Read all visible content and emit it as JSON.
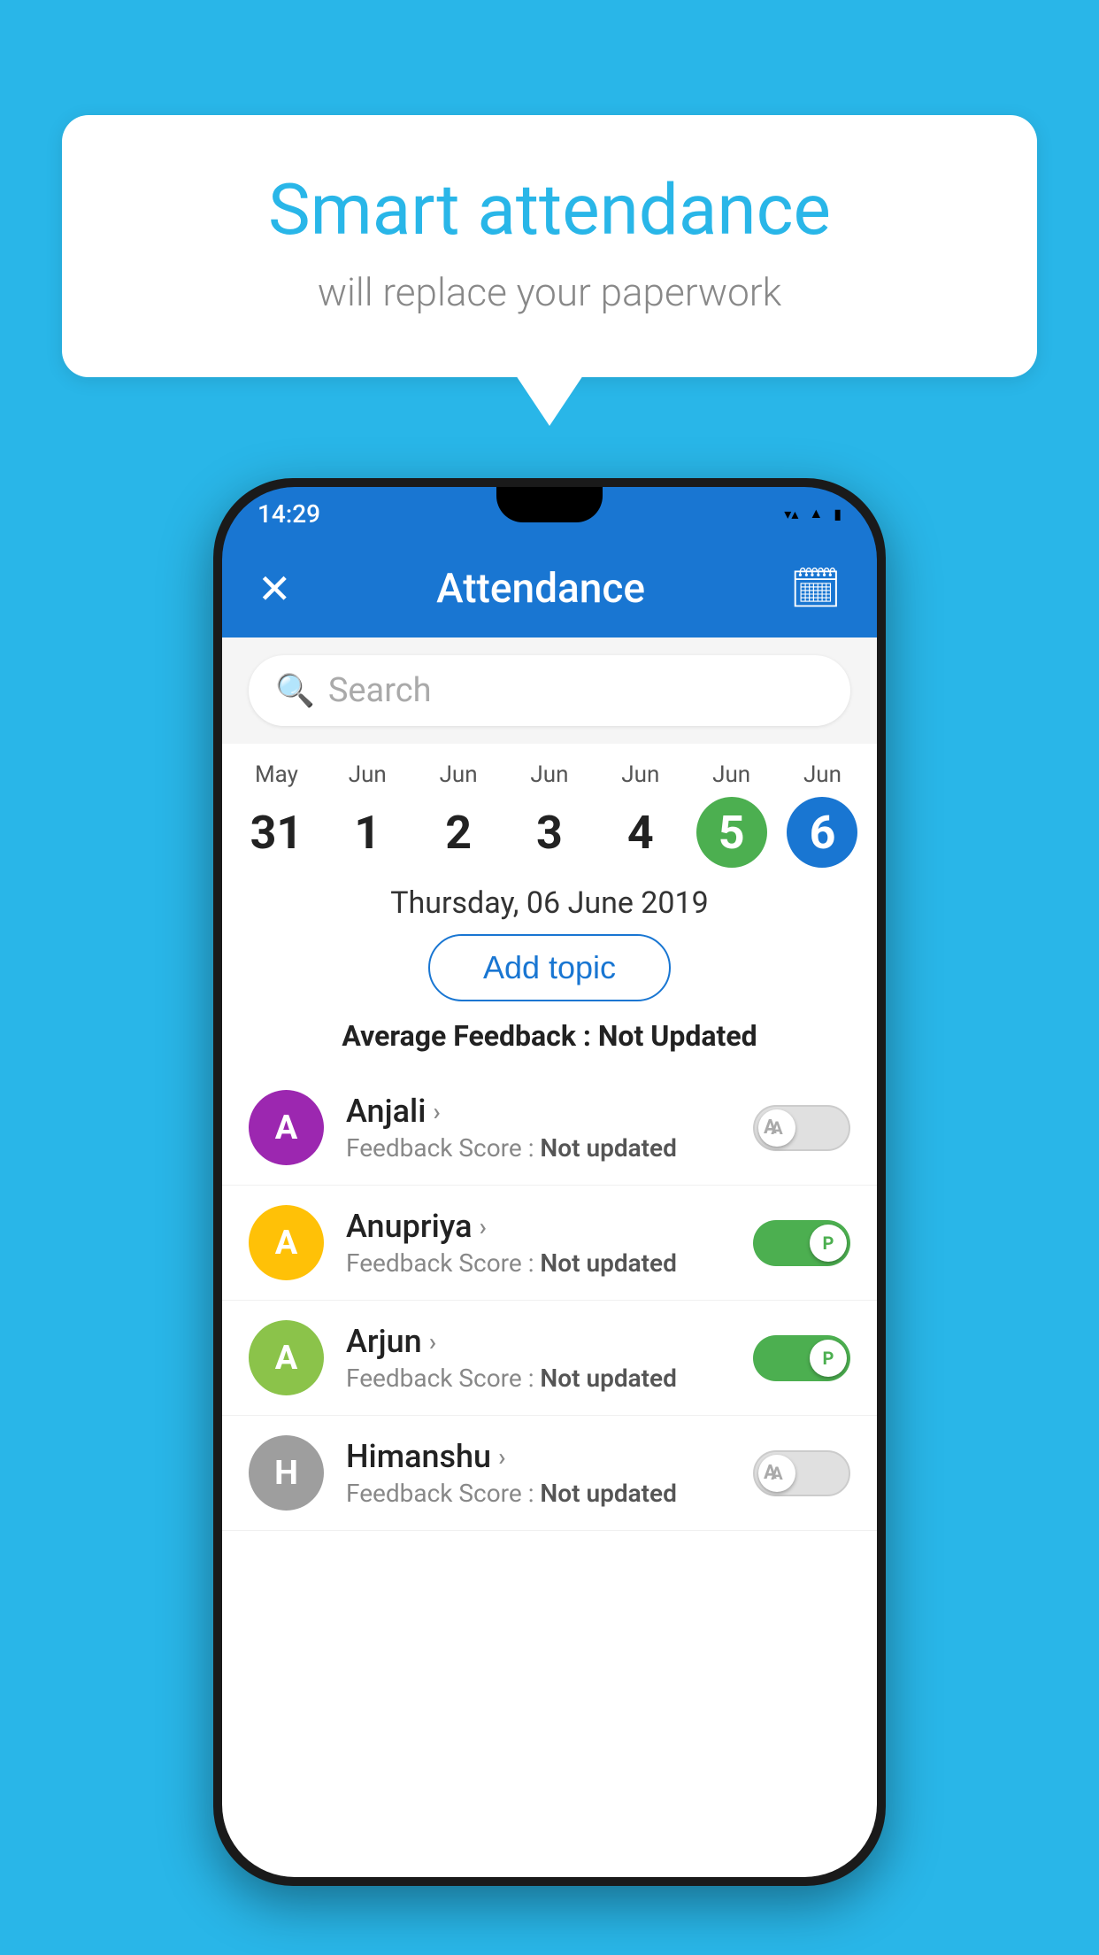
{
  "background_color": "#29B6E8",
  "speech_bubble": {
    "title": "Smart attendance",
    "subtitle": "will replace your paperwork"
  },
  "status_bar": {
    "time": "14:29",
    "wifi": "▼",
    "signal": "▲",
    "battery": "▌"
  },
  "app_bar": {
    "close_icon": "✕",
    "title": "Attendance",
    "calendar_icon": "📅"
  },
  "search": {
    "placeholder": "Search"
  },
  "calendar": {
    "days": [
      {
        "month": "May",
        "number": "31",
        "highlight": "none"
      },
      {
        "month": "Jun",
        "number": "1",
        "highlight": "none"
      },
      {
        "month": "Jun",
        "number": "2",
        "highlight": "none"
      },
      {
        "month": "Jun",
        "number": "3",
        "highlight": "none"
      },
      {
        "month": "Jun",
        "number": "4",
        "highlight": "none"
      },
      {
        "month": "Jun",
        "number": "5",
        "highlight": "green"
      },
      {
        "month": "Jun",
        "number": "6",
        "highlight": "blue"
      }
    ]
  },
  "selected_date": "Thursday, 06 June 2019",
  "add_topic_label": "Add topic",
  "average_feedback": {
    "label": "Average Feedback : ",
    "value": "Not Updated"
  },
  "students": [
    {
      "name": "Anjali",
      "avatar_letter": "A",
      "avatar_color": "#9C27B0",
      "feedback_label": "Feedback Score : ",
      "feedback_value": "Not updated",
      "toggle": "off",
      "toggle_letter": "A"
    },
    {
      "name": "Anupriya",
      "avatar_letter": "A",
      "avatar_color": "#FFC107",
      "feedback_label": "Feedback Score : ",
      "feedback_value": "Not updated",
      "toggle": "on",
      "toggle_letter": "P"
    },
    {
      "name": "Arjun",
      "avatar_letter": "A",
      "avatar_color": "#8BC34A",
      "feedback_label": "Feedback Score : ",
      "feedback_value": "Not updated",
      "toggle": "on",
      "toggle_letter": "P"
    },
    {
      "name": "Himanshu",
      "avatar_letter": "H",
      "avatar_color": "#9E9E9E",
      "feedback_label": "Feedback Score : ",
      "feedback_value": "Not updated",
      "toggle": "off",
      "toggle_letter": "A"
    }
  ],
  "icons": {
    "search": "🔍",
    "close": "✕",
    "calendar": "🗓",
    "chevron": "›"
  }
}
